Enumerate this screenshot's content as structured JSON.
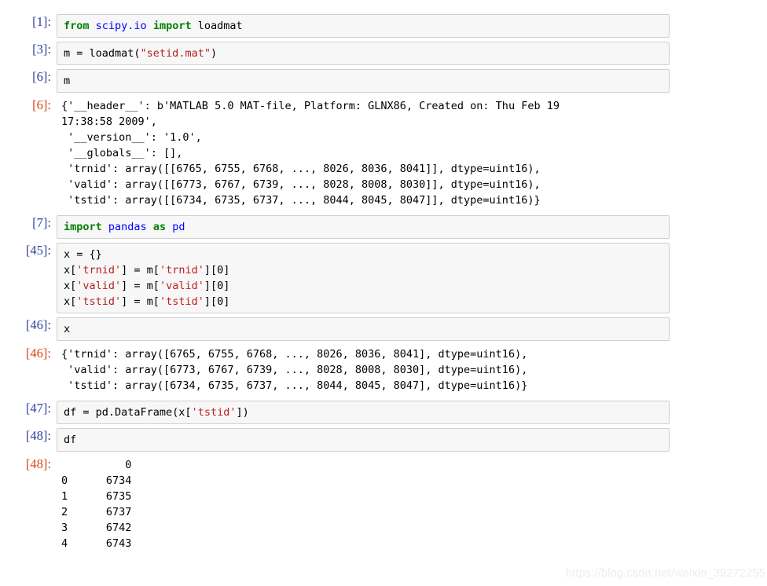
{
  "cells": [
    {
      "type": "input",
      "prompt": "[1]:",
      "tokens": [
        {
          "t": "from",
          "c": "k"
        },
        {
          "t": " ",
          "c": "n"
        },
        {
          "t": "scipy.io",
          "c": "nn"
        },
        {
          "t": " ",
          "c": "n"
        },
        {
          "t": "import",
          "c": "k"
        },
        {
          "t": " loadmat",
          "c": "n"
        }
      ],
      "plain": "from scipy.io import loadmat"
    },
    {
      "type": "input",
      "prompt": "[3]:",
      "tokens": [
        {
          "t": "m = loadmat(",
          "c": "n"
        },
        {
          "t": "\"setid.mat\"",
          "c": "s"
        },
        {
          "t": ")",
          "c": "n"
        }
      ],
      "plain": "m = loadmat(\"setid.mat\")"
    },
    {
      "type": "input",
      "prompt": "[6]:",
      "tokens": [
        {
          "t": "m",
          "c": "n"
        }
      ],
      "plain": "m"
    },
    {
      "type": "output",
      "prompt": "[6]:",
      "text": "{'__header__': b'MATLAB 5.0 MAT-file, Platform: GLNX86, Created on: Thu Feb 19\n17:38:58 2009',\n '__version__': '1.0',\n '__globals__': [],\n 'trnid': array([[6765, 6755, 6768, ..., 8026, 8036, 8041]], dtype=uint16),\n 'valid': array([[6773, 6767, 6739, ..., 8028, 8008, 8030]], dtype=uint16),\n 'tstid': array([[6734, 6735, 6737, ..., 8044, 8045, 8047]], dtype=uint16)}"
    },
    {
      "type": "input",
      "prompt": "[7]:",
      "tokens": [
        {
          "t": "import",
          "c": "k"
        },
        {
          "t": " ",
          "c": "n"
        },
        {
          "t": "pandas",
          "c": "nn"
        },
        {
          "t": " ",
          "c": "n"
        },
        {
          "t": "as",
          "c": "k"
        },
        {
          "t": " ",
          "c": "n"
        },
        {
          "t": "pd",
          "c": "nn"
        }
      ],
      "plain": "import pandas as pd"
    },
    {
      "type": "input",
      "prompt": "[45]:",
      "tokens": [
        {
          "t": "x = {}\nx[",
          "c": "n"
        },
        {
          "t": "'trnid'",
          "c": "s"
        },
        {
          "t": "] = m[",
          "c": "n"
        },
        {
          "t": "'trnid'",
          "c": "s"
        },
        {
          "t": "][0]\nx[",
          "c": "n"
        },
        {
          "t": "'valid'",
          "c": "s"
        },
        {
          "t": "] = m[",
          "c": "n"
        },
        {
          "t": "'valid'",
          "c": "s"
        },
        {
          "t": "][0]\nx[",
          "c": "n"
        },
        {
          "t": "'tstid'",
          "c": "s"
        },
        {
          "t": "] = m[",
          "c": "n"
        },
        {
          "t": "'tstid'",
          "c": "s"
        },
        {
          "t": "][0]",
          "c": "n"
        }
      ],
      "plain": "x = {}\nx['trnid'] = m['trnid'][0]\nx['valid'] = m['valid'][0]\nx['tstid'] = m['tstid'][0]"
    },
    {
      "type": "input",
      "prompt": "[46]:",
      "tokens": [
        {
          "t": "x",
          "c": "n"
        }
      ],
      "plain": "x"
    },
    {
      "type": "output",
      "prompt": "[46]:",
      "text": "{'trnid': array([6765, 6755, 6768, ..., 8026, 8036, 8041], dtype=uint16),\n 'valid': array([6773, 6767, 6739, ..., 8028, 8008, 8030], dtype=uint16),\n 'tstid': array([6734, 6735, 6737, ..., 8044, 8045, 8047], dtype=uint16)}"
    },
    {
      "type": "input",
      "prompt": "[47]:",
      "tokens": [
        {
          "t": "df = pd.DataFrame(x[",
          "c": "n"
        },
        {
          "t": "'tstid'",
          "c": "s"
        },
        {
          "t": "])",
          "c": "n"
        }
      ],
      "plain": "df = pd.DataFrame(x['tstid'])"
    },
    {
      "type": "input",
      "prompt": "[48]:",
      "tokens": [
        {
          "t": "df",
          "c": "n"
        }
      ],
      "plain": "df"
    },
    {
      "type": "output",
      "prompt": "[48]:",
      "text": "          0\n0      6734\n1      6735\n2      6737\n3      6742\n4      6743"
    }
  ],
  "dataframe": {
    "columns": [
      "",
      "0"
    ],
    "rows": [
      [
        "0",
        "6734"
      ],
      [
        "1",
        "6735"
      ],
      [
        "2",
        "6737"
      ],
      [
        "3",
        "6742"
      ],
      [
        "4",
        "6743"
      ]
    ]
  },
  "watermark": {
    "text": "https://blog.csdn.net/weixin_39272255"
  },
  "colors": {
    "prompt_in": "#303f9f",
    "prompt_out": "#d84315",
    "keyword": "#008000",
    "name": "#0000ff",
    "string": "#ba2121",
    "cell_bg": "#f7f7f7",
    "cell_border": "#cfcfcf",
    "page_bg": "#ffffff",
    "watermark": "#ededed"
  }
}
